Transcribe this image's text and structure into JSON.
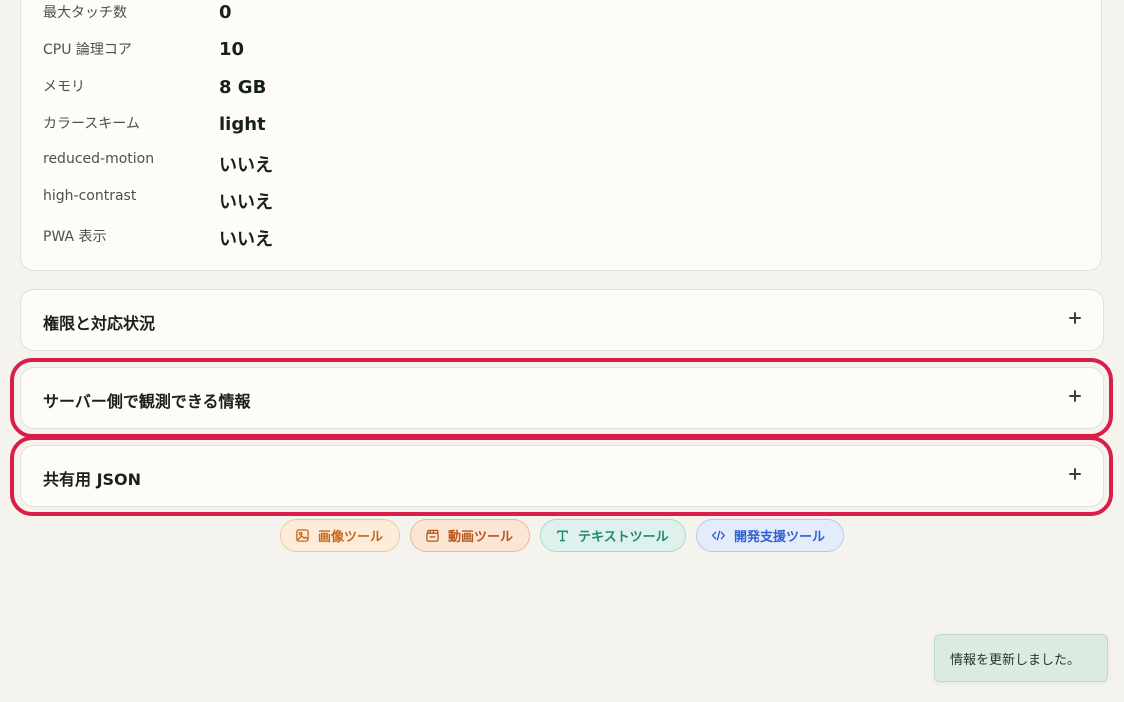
{
  "device_info": {
    "rows": [
      {
        "label": "最大タッチ数",
        "value": "0"
      },
      {
        "label": "CPU 論理コア",
        "value": "10"
      },
      {
        "label": "メモリ",
        "value": "8 GB"
      },
      {
        "label": "カラースキーム",
        "value": "light"
      },
      {
        "label": "reduced-motion",
        "value": "いいえ"
      },
      {
        "label": "high-contrast",
        "value": "いいえ"
      },
      {
        "label": "PWA 表示",
        "value": "いいえ"
      }
    ]
  },
  "sections": [
    {
      "title": "権限と対応状況",
      "icon": "plus-icon"
    },
    {
      "title": "サーバー側で観測できる情報",
      "icon": "plus-icon"
    },
    {
      "title": "共有用 JSON",
      "icon": "plus-icon"
    }
  ],
  "tool_links": [
    {
      "label": "画像ツール",
      "icon": "image-icon",
      "color": "#c8671a"
    },
    {
      "label": "動画ツール",
      "icon": "video-icon",
      "color": "#b8561a"
    },
    {
      "label": "テキストツール",
      "icon": "text-icon",
      "color": "#1d8a76"
    },
    {
      "label": "開発支援ツール",
      "icon": "code-icon",
      "color": "#2f5fd0"
    }
  ],
  "toast": {
    "message": "情報を更新しました。"
  },
  "colors": {
    "highlight": "#d91e4a",
    "background": "#f5f3ee",
    "card": "#fdfcf8",
    "toast_bg": "#dcebdf"
  }
}
